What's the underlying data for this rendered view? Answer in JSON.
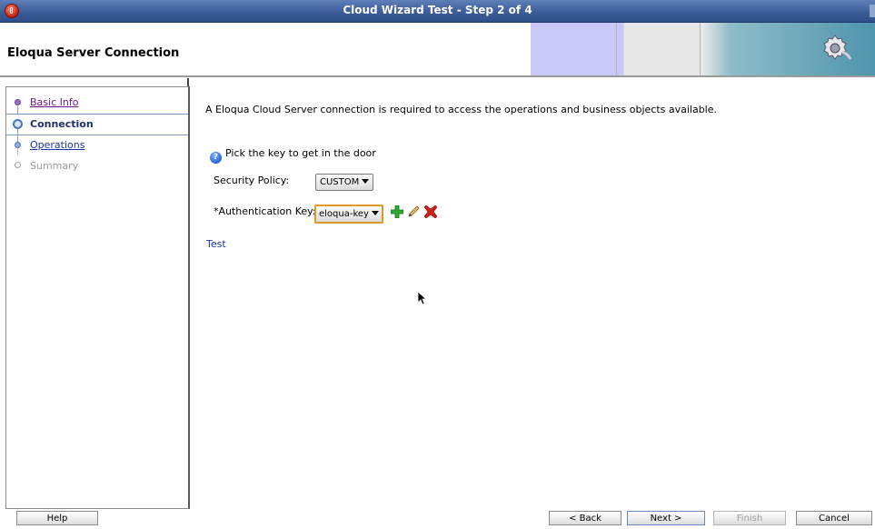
{
  "window": {
    "title": "Cloud Wizard Test - Step 2 of 4"
  },
  "header": {
    "title": "Eloqua Server Connection"
  },
  "steps": [
    {
      "label": "Basic Info",
      "state": "visited"
    },
    {
      "label": "Connection",
      "state": "current"
    },
    {
      "label": "Operations",
      "state": "link"
    },
    {
      "label": "Summary",
      "state": "disabled"
    }
  ],
  "main": {
    "intro": "A Eloqua Cloud Server connection is required to access the operations and business objects available.",
    "help_text": "Pick the key to get in the door",
    "security_policy_label": "Security Policy:",
    "security_policy_value": "CUSTOM",
    "auth_key_label": "*Authentication Key:",
    "auth_key_value": "eloqua-key",
    "test_link": "Test"
  },
  "buttons": {
    "help": "Help",
    "back": "< Back",
    "next": "Next >",
    "finish": "Finish",
    "cancel": "Cancel"
  },
  "icons": {
    "app": "oracle-app-icon",
    "banner": "gear-icon",
    "help": "help-icon",
    "add": "add-icon",
    "edit": "edit-icon",
    "delete": "delete-icon"
  },
  "colors": {
    "titlebar": "#3c5d99",
    "link": "#1d34a8",
    "focus_border": "#e09a27",
    "add": "#2eaa2e",
    "delete": "#d0201a"
  }
}
